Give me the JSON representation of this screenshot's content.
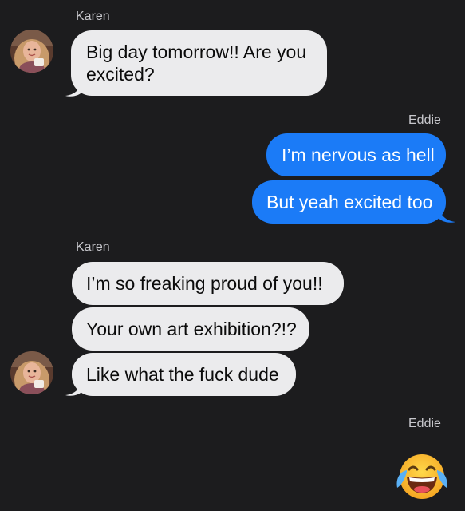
{
  "colors": {
    "background": "#1c1c1e",
    "incoming_bubble": "#ebebed",
    "outgoing_bubble": "#1b7bf7",
    "sender_label": "#c7c7cc"
  },
  "messages": [
    {
      "sender": "Karen",
      "direction": "incoming",
      "text_lines": [
        "Big day tomorrow!! Are you",
        "excited?"
      ],
      "avatar": "profile-photo"
    },
    {
      "sender": "Eddie",
      "direction": "outgoing",
      "text": "I’m nervous as hell"
    },
    {
      "sender": "Eddie",
      "direction": "outgoing",
      "text": "But yeah excited too"
    },
    {
      "sender": "Karen",
      "direction": "incoming",
      "text": "I’m so freaking proud of you!!"
    },
    {
      "sender": "Karen",
      "direction": "incoming",
      "text": "Your own art exhibition?!?"
    },
    {
      "sender": "Karen",
      "direction": "incoming",
      "text": "Like what the fuck dude",
      "avatar": "profile-photo"
    },
    {
      "sender": "Eddie",
      "direction": "outgoing",
      "emoji": "face-with-tears-of-joy"
    }
  ]
}
